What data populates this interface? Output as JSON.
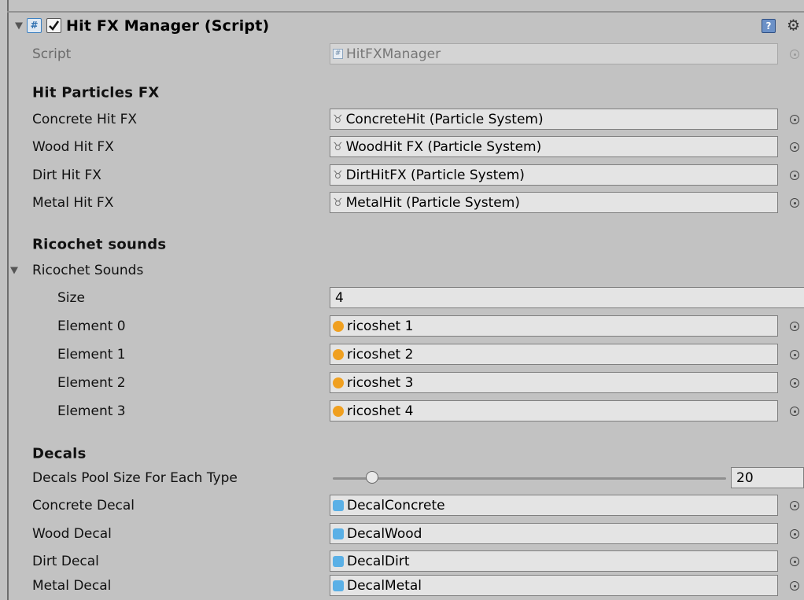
{
  "component": {
    "title": "Hit FX Manager (Script)",
    "enabled": true
  },
  "script": {
    "label": "Script",
    "value": "HitFXManager"
  },
  "sections": {
    "hit_particles": "Hit Particles FX",
    "ricochet": "Ricochet sounds",
    "decals": "Decals"
  },
  "particles": [
    {
      "label": "Concrete Hit FX",
      "value": "ConcreteHit (Particle System)"
    },
    {
      "label": "Wood Hit FX",
      "value": "WoodHit FX (Particle System)"
    },
    {
      "label": "Dirt Hit FX",
      "value": "DirtHitFX (Particle System)"
    },
    {
      "label": "Metal Hit FX",
      "value": "MetalHit (Particle System)"
    }
  ],
  "ricochet_array": {
    "label": "Ricochet Sounds",
    "size_label": "Size",
    "size": "4",
    "elements": [
      {
        "label": "Element 0",
        "value": "ricoshet 1"
      },
      {
        "label": "Element 1",
        "value": "ricoshet 2"
      },
      {
        "label": "Element 2",
        "value": "ricoshet 3"
      },
      {
        "label": "Element 3",
        "value": "ricoshet 4"
      }
    ]
  },
  "pool": {
    "label": "Decals Pool Size For Each Type",
    "value": "20",
    "slider_fraction": 0.1
  },
  "decals": [
    {
      "label": "Concrete Decal",
      "value": "DecalConcrete"
    },
    {
      "label": "Wood Decal",
      "value": "DecalWood"
    },
    {
      "label": "Dirt Decal",
      "value": "DecalDirt"
    },
    {
      "label": "Metal Decal",
      "value": "DecalMetal"
    }
  ],
  "icons": {
    "fold": "triangle-down-icon",
    "script": "csharp-script-icon",
    "checkbox": "checkbox-checked-icon",
    "help": "help-book-icon",
    "settings": "gear-icon",
    "particle": "particle-system-icon",
    "audio": "audio-clip-icon",
    "prefab": "prefab-cube-icon",
    "picker": "object-picker-icon"
  }
}
